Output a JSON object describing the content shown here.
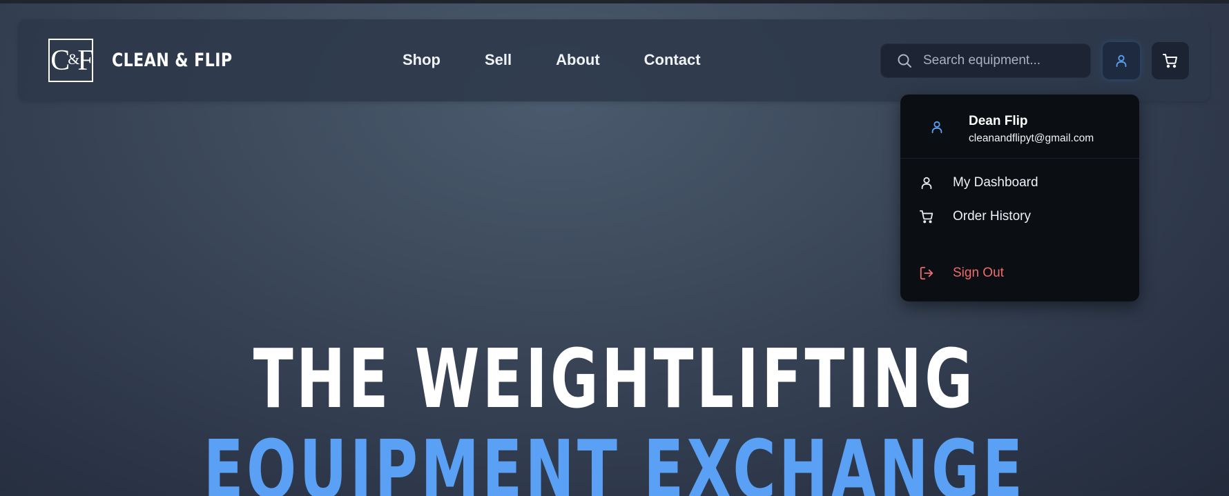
{
  "brand": {
    "logo_mark_left": "C",
    "logo_mark_amp": "&",
    "logo_mark_right": "F",
    "name": "CLEAN & FLIP"
  },
  "nav": {
    "items": [
      {
        "label": "Shop"
      },
      {
        "label": "Sell"
      },
      {
        "label": "About"
      },
      {
        "label": "Contact"
      }
    ]
  },
  "search": {
    "placeholder": "Search equipment...",
    "value": "",
    "icon": "search-icon"
  },
  "header_actions": {
    "user_icon": "user-icon",
    "cart_icon": "cart-icon"
  },
  "user_menu": {
    "name": "Dean Flip",
    "email": "cleanandflipyt@gmail.com",
    "items": [
      {
        "label": "My Dashboard",
        "icon": "user-icon"
      },
      {
        "label": "Order History",
        "icon": "cart-icon"
      }
    ],
    "sign_out": {
      "label": "Sign Out",
      "icon": "sign-out-icon"
    }
  },
  "hero": {
    "line1": "THE WEIGHTLIFTING",
    "line2": "EQUIPMENT EXCHANGE"
  },
  "colors": {
    "accent": "#5aa0f5",
    "danger": "#f06b6b",
    "dropdown_bg": "#0b0f14",
    "navbar_bg": "#2d384a"
  }
}
